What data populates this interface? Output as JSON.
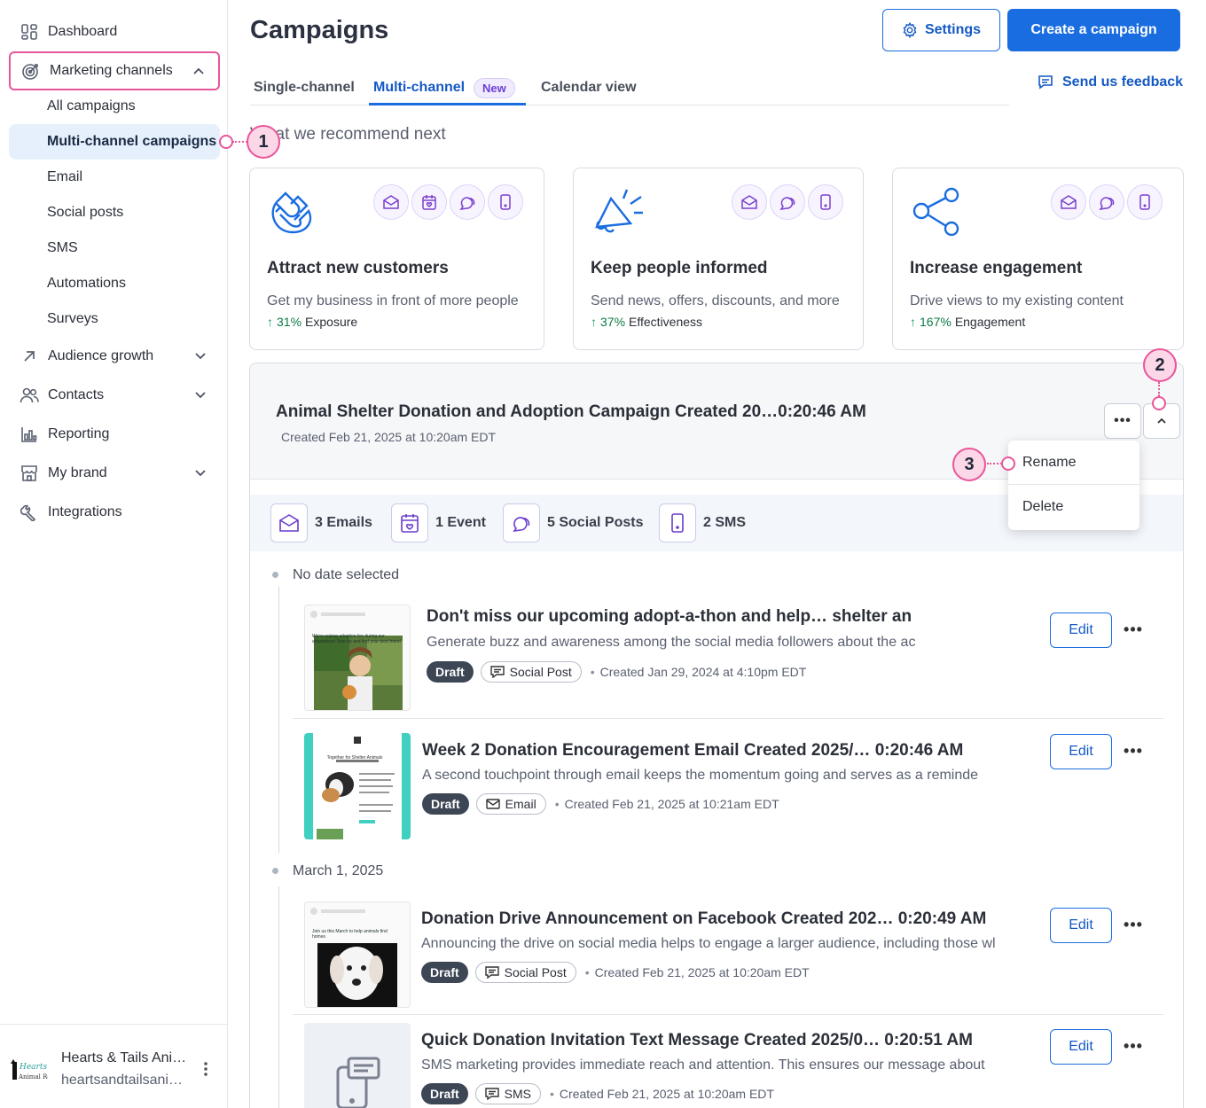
{
  "sidebar": {
    "items": [
      {
        "label": "Dashboard",
        "icon": "dashboard-icon"
      },
      {
        "label": "Marketing channels",
        "icon": "target-icon"
      },
      {
        "label": "Audience growth",
        "icon": "arrow-up-right-icon"
      },
      {
        "label": "Contacts",
        "icon": "people-icon"
      },
      {
        "label": "Reporting",
        "icon": "chart-icon"
      },
      {
        "label": "My brand",
        "icon": "store-icon"
      },
      {
        "label": "Integrations",
        "icon": "tools-icon"
      }
    ],
    "sub_items": [
      "All campaigns",
      "Multi-channel campaigns",
      "Email",
      "Social posts",
      "SMS",
      "Automations",
      "Surveys"
    ],
    "org_name": "Hearts & Tails Ani…",
    "org_email": "heartsandtailsani…",
    "logo_text": "Hearts & Tails Animal Rescue"
  },
  "header": {
    "title": "Campaigns",
    "settings_label": "Settings",
    "create_label": "Create a campaign",
    "feedback_label": "Send us feedback"
  },
  "tabs": [
    {
      "label": "Single-channel"
    },
    {
      "label": "Multi-channel",
      "badge": "New"
    },
    {
      "label": "Calendar view"
    }
  ],
  "recommend": {
    "title": "What we recommend next",
    "cards": [
      {
        "title": "Attract new customers",
        "desc": "Get my business in front of more people",
        "pct": "31%",
        "stat": "Exposure"
      },
      {
        "title": "Keep people informed",
        "desc": "Send news, offers, discounts, and more",
        "pct": "37%",
        "stat": "Effectiveness"
      },
      {
        "title": "Increase engagement",
        "desc": "Drive views to my existing content",
        "pct": "167%",
        "stat": "Engagement"
      }
    ]
  },
  "campaign": {
    "title": "Animal Shelter Donation and Adoption Campaign Created 20…0:20:46 AM",
    "created": "Created Feb 21, 2025 at 10:20am EDT",
    "summary": [
      "3 Emails",
      "1 Event",
      "5 Social Posts",
      "2 SMS"
    ],
    "menu": [
      "Rename",
      "Delete"
    ],
    "groups": [
      {
        "date": "No date selected"
      },
      {
        "date": "March 1, 2025"
      }
    ],
    "rows": [
      {
        "title": "Don't miss our upcoming adopt-a-thon and help… shelter an",
        "desc": "Generate buzz and awareness among the social media followers about the ac",
        "status": "Draft",
        "type": "Social Post",
        "created": "Created Jan 29, 2024 at 4:10pm EDT",
        "edit": "Edit",
        "thumb_text": "We're raising adoption fee during our adoptathon! Stop by and find your best friend"
      },
      {
        "title": "Week 2 Donation Encouragement Email Created 2025/… 0:20:46 AM",
        "desc": "A second touchpoint through email keeps the momentum going and serves as a reminde",
        "status": "Draft",
        "type": "Email",
        "created": "Created Feb 21, 2025 at 10:21am EDT",
        "edit": "Edit",
        "thumb_text": "Together for Shelter Animals"
      },
      {
        "title": "Donation Drive Announcement on Facebook Created 202… 0:20:49 AM",
        "desc": "Announcing the drive on social media helps to engage a larger audience, including those wl",
        "status": "Draft",
        "type": "Social Post",
        "created": "Created Feb 21, 2025 at 10:20am EDT",
        "edit": "Edit",
        "thumb_text": "Join us this March to help animals find homes"
      },
      {
        "title": "Quick Donation Invitation Text Message Created 2025/0… 0:20:51 AM",
        "desc": "SMS marketing provides immediate reach and attention. This ensures our message about",
        "status": "Draft",
        "type": "SMS",
        "created": "Created Feb 21, 2025 at 10:20am EDT",
        "edit": "Edit"
      }
    ]
  },
  "callouts": [
    "1",
    "2",
    "3"
  ],
  "colors": {
    "accent": "#1a6de0",
    "highlight": "#e8569a",
    "channel": "#7a3fcc"
  }
}
